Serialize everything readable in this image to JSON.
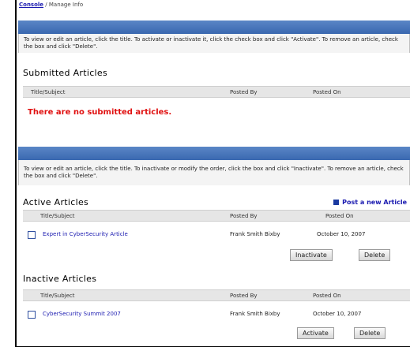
{
  "breadcrumb": {
    "home": "Console",
    "current": "/ Manage Info"
  },
  "submitted_panel": {
    "instructions": "To view or edit an article, click the title. To activate or inactivate it, click the check box and click \"Activate\". To remove an article, check the box and click \"Delete\".",
    "section_title": "Submitted Articles",
    "columns": [
      "Title/Subject",
      "Posted By",
      "Posted On"
    ],
    "empty_message": "There are no submitted articles."
  },
  "active_panel": {
    "instructions": "To view or edit an article, click the title. To inactivate or modify the order, click the box and click \"Inactivate\". To remove an article, check the box and click \"Delete\".",
    "section_title": "Active Articles",
    "post_link": "Post a new Article",
    "columns": [
      "Title/Subject",
      "Posted By",
      "Posted On"
    ],
    "rows": [
      {
        "title": "Expert in CyberSecurity Article",
        "posted_by": "Frank Smith Bixby",
        "posted_on": "October 10, 2007"
      }
    ],
    "inactivate_label": "Inactivate",
    "delete_label": "Delete"
  },
  "inactive_panel": {
    "section_title": "Inactive Articles",
    "columns": [
      "Title/Subject",
      "Posted By",
      "Posted On"
    ],
    "rows": [
      {
        "title": "CyberSecurity Summit 2007",
        "posted_by": "Frank Smith Bixby",
        "posted_on": "October 10, 2007"
      }
    ],
    "activate_label": "Activate",
    "delete_label": "Delete"
  }
}
